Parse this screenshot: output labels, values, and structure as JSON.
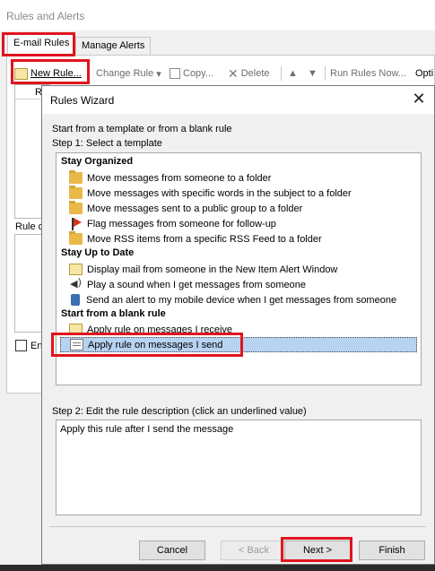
{
  "outer_window": {
    "title": "Rules and Alerts",
    "tabs": [
      {
        "label": "E-mail Rules",
        "active": true
      },
      {
        "label": "Manage Alerts",
        "active": false
      }
    ],
    "toolbar": {
      "new_rule": "New Rule...",
      "change_rule": "Change Rule",
      "copy": "Copy...",
      "delete": "Delete",
      "run_rules_now": "Run Rules Now...",
      "options": "Opti"
    },
    "list_header": "R",
    "rule_description_label": "Rule d",
    "enable_label": "En"
  },
  "wizard": {
    "title": "Rules Wizard",
    "intro": "Start from a template or from a blank rule",
    "step1_label": "Step 1: Select a template",
    "groups": [
      {
        "name": "Stay Organized",
        "items": [
          {
            "label": "Move messages from someone to a folder",
            "icon": "folder-icon"
          },
          {
            "label": "Move messages with specific words in the subject to a folder",
            "icon": "folder-icon"
          },
          {
            "label": "Move messages sent to a public group to a folder",
            "icon": "folder-icon"
          },
          {
            "label": "Flag messages from someone for follow-up",
            "icon": "flag-icon"
          },
          {
            "label": "Move RSS items from a specific RSS Feed to a folder",
            "icon": "folder-icon"
          }
        ]
      },
      {
        "name": "Stay Up to Date",
        "items": [
          {
            "label": "Display mail from someone in the New Item Alert Window",
            "icon": "mail-alert-icon"
          },
          {
            "label": "Play a sound when I get messages from someone",
            "icon": "speaker-icon"
          },
          {
            "label": "Send an alert to my mobile device when I get messages from someone",
            "icon": "phone-icon"
          }
        ]
      },
      {
        "name": "Start from a blank rule",
        "items": [
          {
            "label": "Apply rule on messages I receive",
            "icon": "mail-icon"
          },
          {
            "label": "Apply rule on messages I send",
            "icon": "mail-send-icon",
            "selected": true
          }
        ]
      }
    ],
    "step2_label": "Step 2: Edit the rule description (click an underlined value)",
    "description": "Apply this rule after I send the message",
    "buttons": {
      "cancel": "Cancel",
      "back": "< Back",
      "next": "Next >",
      "finish": "Finish"
    }
  },
  "colors": {
    "highlight": "#e0141e",
    "selection": "#b6d3f2"
  }
}
